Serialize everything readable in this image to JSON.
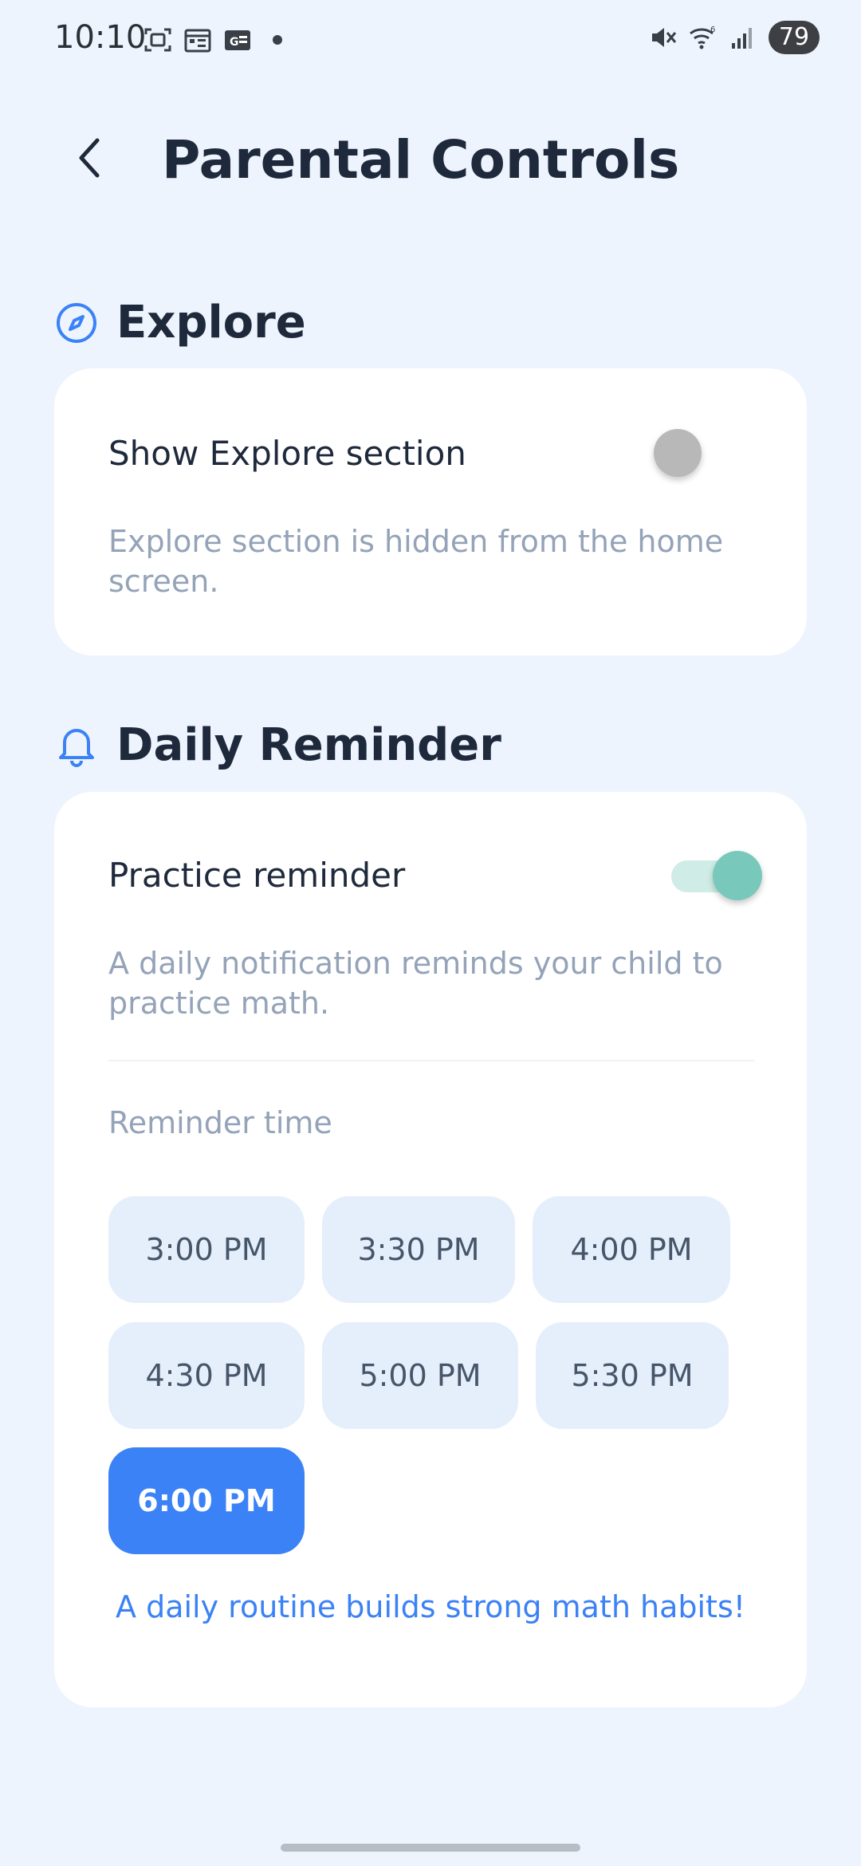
{
  "status_bar": {
    "time": "10:10",
    "battery": "79",
    "left_icons": [
      "screenshot-icon",
      "calendar-icon",
      "news-icon"
    ],
    "right_icons": [
      "mute-icon",
      "wifi-icon",
      "signal-icon"
    ]
  },
  "header": {
    "title": "Parental Controls"
  },
  "explore": {
    "title": "Explore",
    "icon": "compass-icon",
    "toggle_label": "Show Explore section",
    "toggle_on": false,
    "description": "Explore section is hidden from the home screen."
  },
  "daily_reminder": {
    "title": "Daily Reminder",
    "icon": "bell-icon",
    "toggle_label": "Practice reminder",
    "toggle_on": true,
    "description": "A daily notification reminds your child to practice math.",
    "time_label": "Reminder time",
    "times": [
      "3:00 PM",
      "3:30 PM",
      "4:00 PM",
      "4:30 PM",
      "5:00 PM",
      "5:30 PM",
      "6:00 PM"
    ],
    "selected_time": "6:00 PM",
    "footer": "A daily routine builds strong math habits!"
  },
  "colors": {
    "background": "#eef4fd",
    "accent": "#3b82f6",
    "toggle_on": "#78c9bb",
    "toggle_off": "#b8b8b8",
    "chip": "#e5effc"
  }
}
